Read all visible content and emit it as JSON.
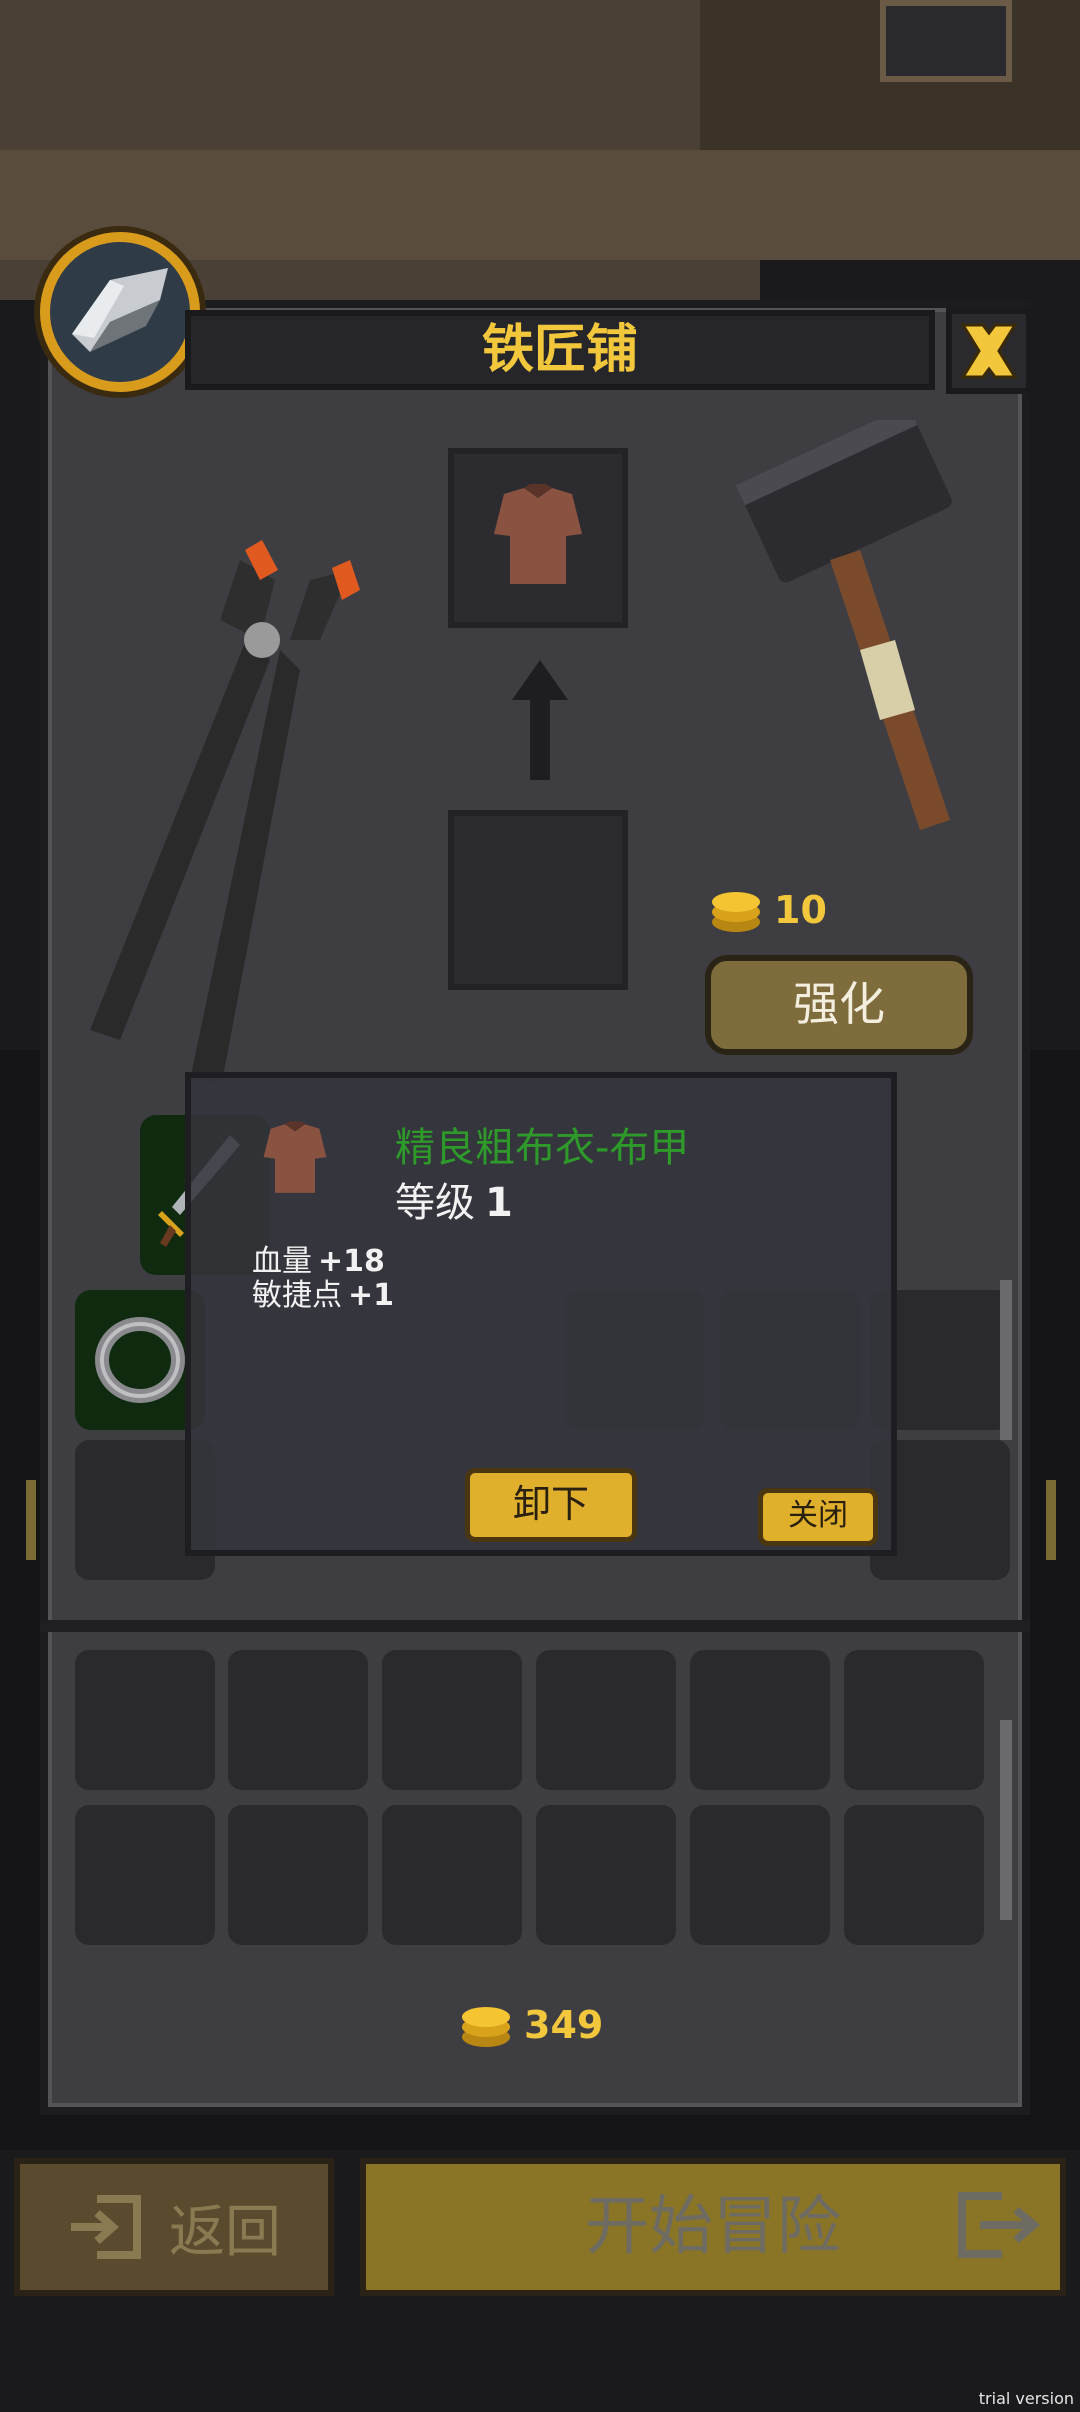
{
  "title": "铁匠铺",
  "forge": {
    "cost": "10",
    "enhance_label": "强化"
  },
  "tooltip": {
    "item_name": "精良粗布衣-布甲",
    "level_label": "等级",
    "level_value": "1",
    "stats": [
      {
        "label": "血量",
        "value": "+18"
      },
      {
        "label": "敏捷点",
        "value": "+1"
      }
    ],
    "unequip_label": "卸下",
    "close_label": "关闭"
  },
  "gold_total": "349",
  "bottom": {
    "back_label": "返回",
    "start_label": "开始冒险"
  },
  "watermark": "trial version",
  "colors": {
    "accent_gold": "#f2c73c",
    "item_quality_green": "#2e9a2a",
    "panel": "#3e3e42"
  },
  "icons": [
    "anvil-badge-icon",
    "close-x-icon",
    "tongs-icon",
    "hammer-icon",
    "tunic-icon",
    "up-arrow-icon",
    "gold-coin-icon",
    "sword-icon",
    "ring-icon",
    "exit-icon",
    "enter-icon"
  ]
}
